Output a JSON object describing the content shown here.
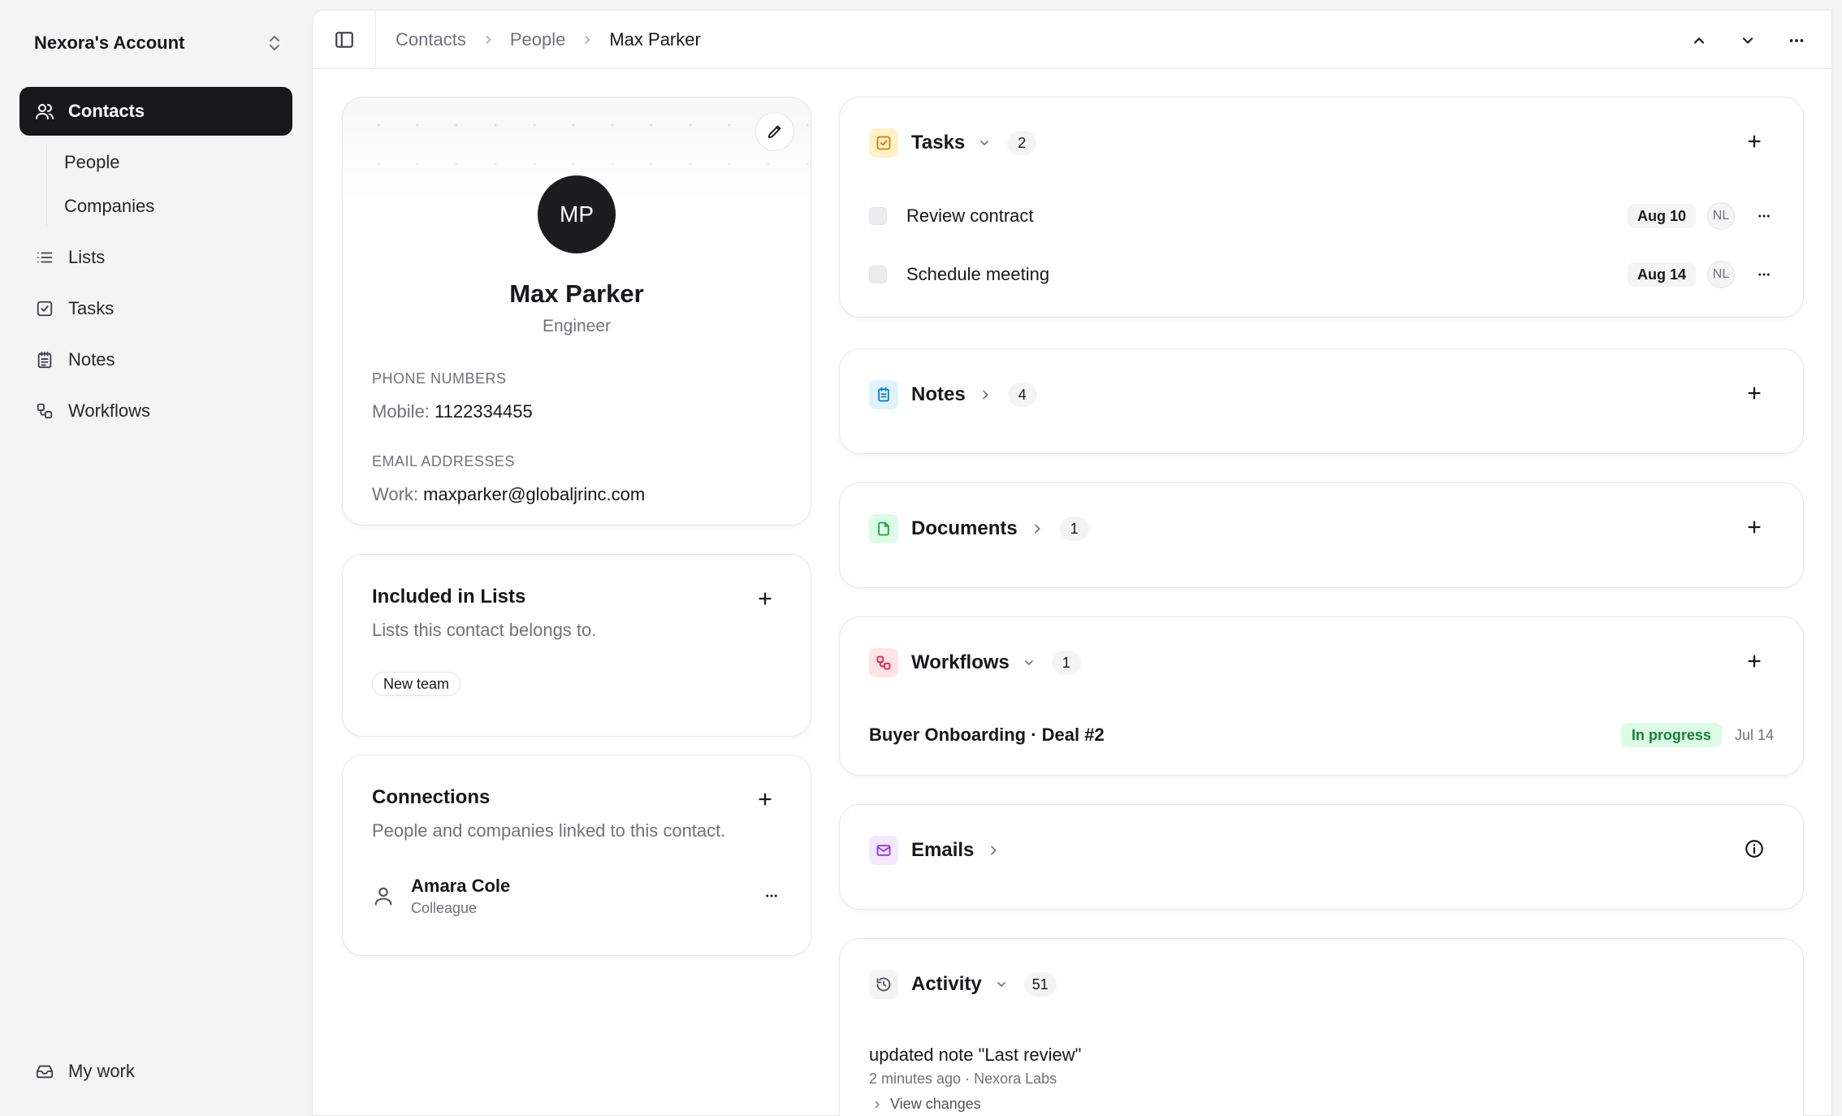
{
  "account": {
    "name": "Nexora's Account"
  },
  "sidebar": {
    "items": [
      {
        "label": "Contacts"
      },
      {
        "label": "Lists"
      },
      {
        "label": "Tasks"
      },
      {
        "label": "Notes"
      },
      {
        "label": "Workflows"
      }
    ],
    "sub_items": [
      {
        "label": "People"
      },
      {
        "label": "Companies"
      }
    ],
    "footer": {
      "label": "My work"
    }
  },
  "breadcrumb": [
    "Contacts",
    "People",
    "Max Parker"
  ],
  "profile": {
    "initials": "MP",
    "name": "Max Parker",
    "role": "Engineer",
    "phone_label": "PHONE NUMBERS",
    "phone_key": "Mobile:",
    "phone_value": "1122334455",
    "email_label": "EMAIL ADDRESSES",
    "email_key": "Work:",
    "email_value": "maxparker@globaljrinc.com"
  },
  "lists_card": {
    "title": "Included in Lists",
    "description": "Lists this contact belongs to.",
    "chips": [
      "New team"
    ]
  },
  "connections_card": {
    "title": "Connections",
    "description": "People and companies linked to this contact.",
    "items": [
      {
        "name": "Amara Cole",
        "relation": "Colleague"
      }
    ]
  },
  "tasks": {
    "title": "Tasks",
    "count": "2",
    "items": [
      {
        "text": "Review contract",
        "date": "Aug 10",
        "assignee": "NL"
      },
      {
        "text": "Schedule meeting",
        "date": "Aug 14",
        "assignee": "NL"
      }
    ]
  },
  "notes": {
    "title": "Notes",
    "count": "4"
  },
  "documents": {
    "title": "Documents",
    "count": "1"
  },
  "workflows": {
    "title": "Workflows",
    "count": "1",
    "items": [
      {
        "name": "Buyer Onboarding · Deal #2",
        "status": "In progress",
        "date": "Jul 14"
      }
    ]
  },
  "emails": {
    "title": "Emails"
  },
  "activity": {
    "title": "Activity",
    "count": "51",
    "items": [
      {
        "text": "updated note \"Last review\"",
        "meta": "2 minutes ago · Nexora Labs",
        "action": "View changes"
      }
    ]
  },
  "colors": {
    "tasks_badge": "#fef3c7",
    "notes_badge": "#e0f2fe",
    "documents_badge": "#dcfce7",
    "workflows_badge": "#ffe4e6",
    "emails_badge": "#f3e8ff",
    "status_green": "#15803d"
  }
}
